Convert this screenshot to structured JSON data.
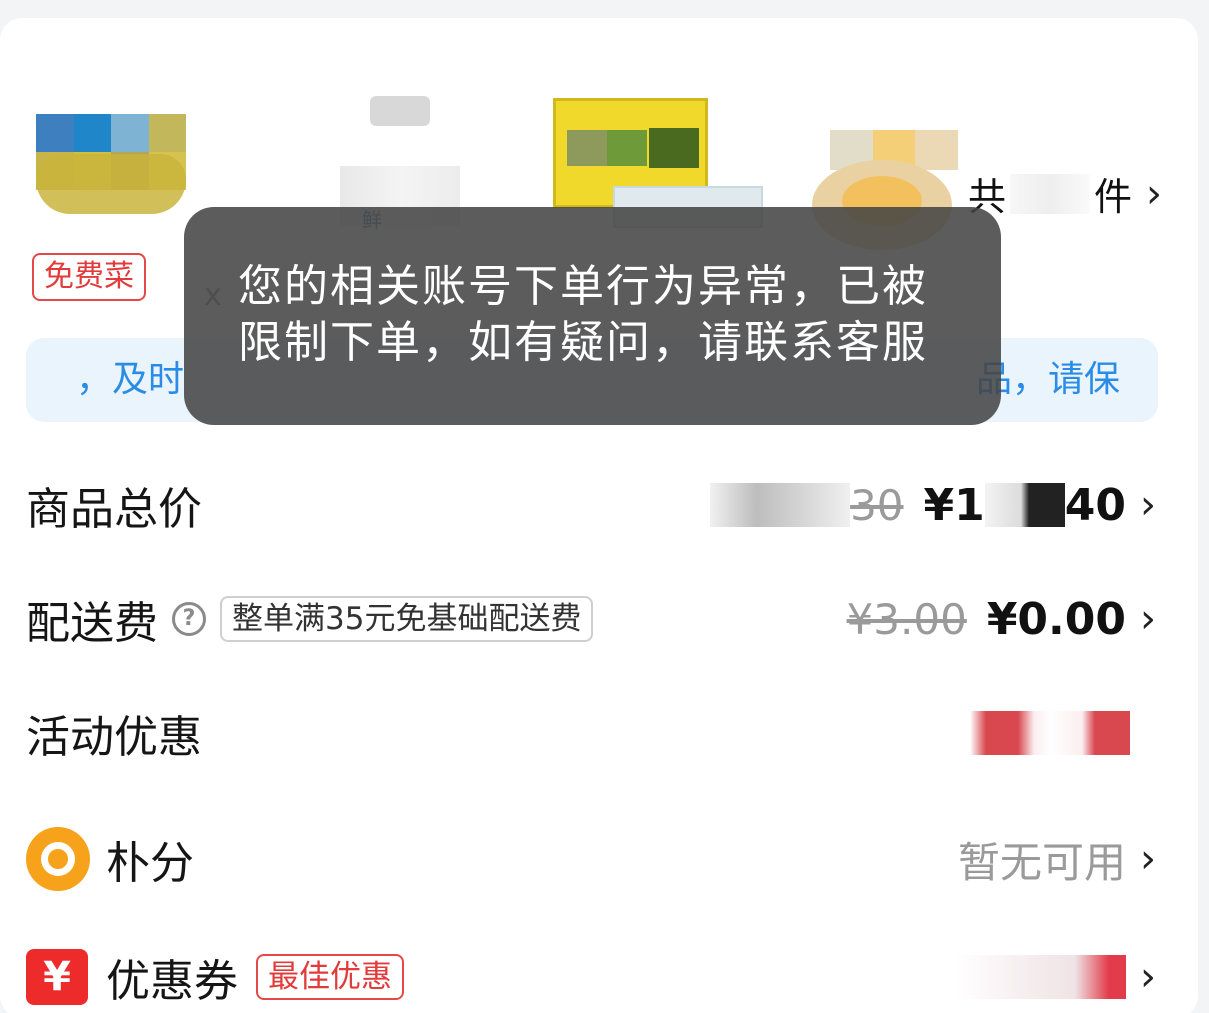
{
  "products": {
    "free_tag": "免费菜",
    "count_prefix": "共",
    "count_suffix": "件",
    "bottle_label": "鲜",
    "qty_hint": "x"
  },
  "notice": {
    "left_text": "，及时",
    "right_text": "品，请保"
  },
  "rows": {
    "goods_total": {
      "label": "商品总价",
      "original_price_tail": "30",
      "price_prefix": "¥1",
      "price_tail": "40"
    },
    "shipping": {
      "label": "配送费",
      "help_icon": "?",
      "badge": "整单满35元免基础配送费",
      "original_price": "¥3.00",
      "price": "¥0.00"
    },
    "activity": {
      "label": "活动优惠"
    },
    "points": {
      "label": "朴分",
      "value": "暂无可用"
    },
    "coupon": {
      "label": "优惠券",
      "icon": "¥",
      "badge": "最佳优惠"
    }
  },
  "toast": {
    "line1": "您的相关账号下单行为异常，已被",
    "line2": "限制下单，如有疑问，请联系客服"
  },
  "chevron": "›",
  "colors": {
    "accent_red": "#e23b3b",
    "accent_blue": "#2b8ce6",
    "points_orange": "#f6a21b",
    "toast_bg": "#464646"
  }
}
